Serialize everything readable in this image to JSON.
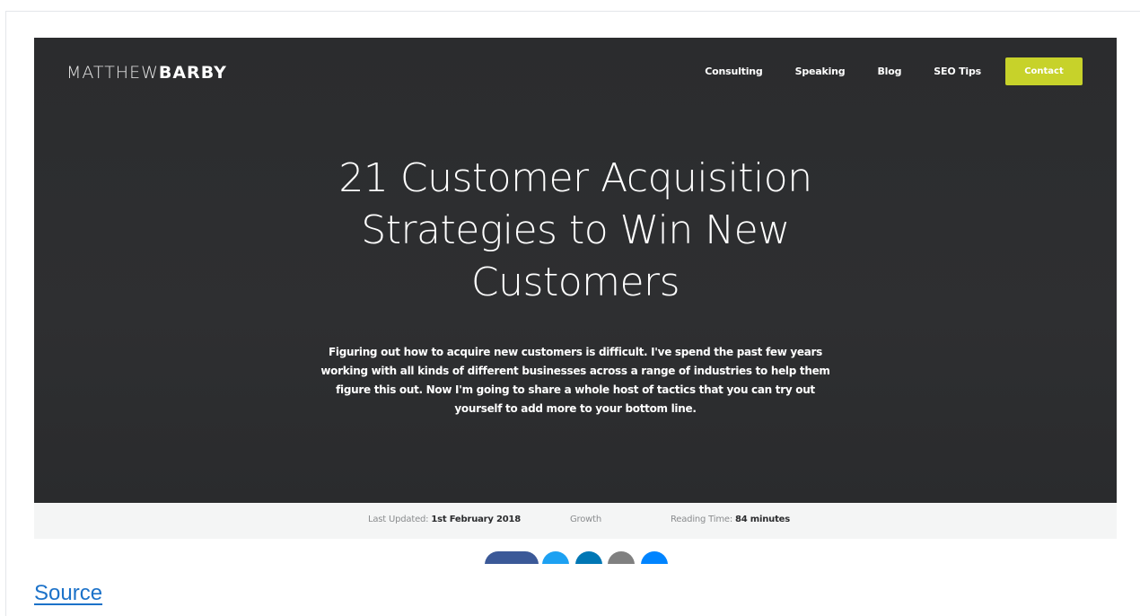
{
  "site": {
    "logo_light": "MATTHEW",
    "logo_bold": "BARBY"
  },
  "nav": {
    "items": [
      "Consulting",
      "Speaking",
      "Blog",
      "SEO Tips"
    ],
    "contact_label": "Contact",
    "contact_color": "#c7d22a"
  },
  "hero": {
    "title": "21 Customer Acquisition Strategies to Win New Customers",
    "subtitle": "Figuring out how to acquire new customers is difficult. I've spend the past few years working with all kinds of different businesses across a range of industries to help them figure this out. Now I'm going to share a whole host of tactics that you can try out yourself to add more to your bottom line.",
    "background": "#2c2d2f"
  },
  "meta": {
    "updated_label": "Last Updated:",
    "updated_value": "1st February 2018",
    "category": "Growth",
    "reading_label": "Reading Time:",
    "reading_value": "84 minutes"
  },
  "share": {
    "buttons": [
      {
        "icon": "facebook-icon",
        "color": "#3b5998"
      },
      {
        "icon": "twitter-icon",
        "color": "#1da1f2"
      },
      {
        "icon": "linkedin-icon",
        "color": "#0077b5"
      },
      {
        "icon": "email-icon",
        "color": "#808080"
      },
      {
        "icon": "messenger-icon",
        "color": "#0084ff"
      }
    ]
  },
  "footer": {
    "source_label": "Source"
  }
}
